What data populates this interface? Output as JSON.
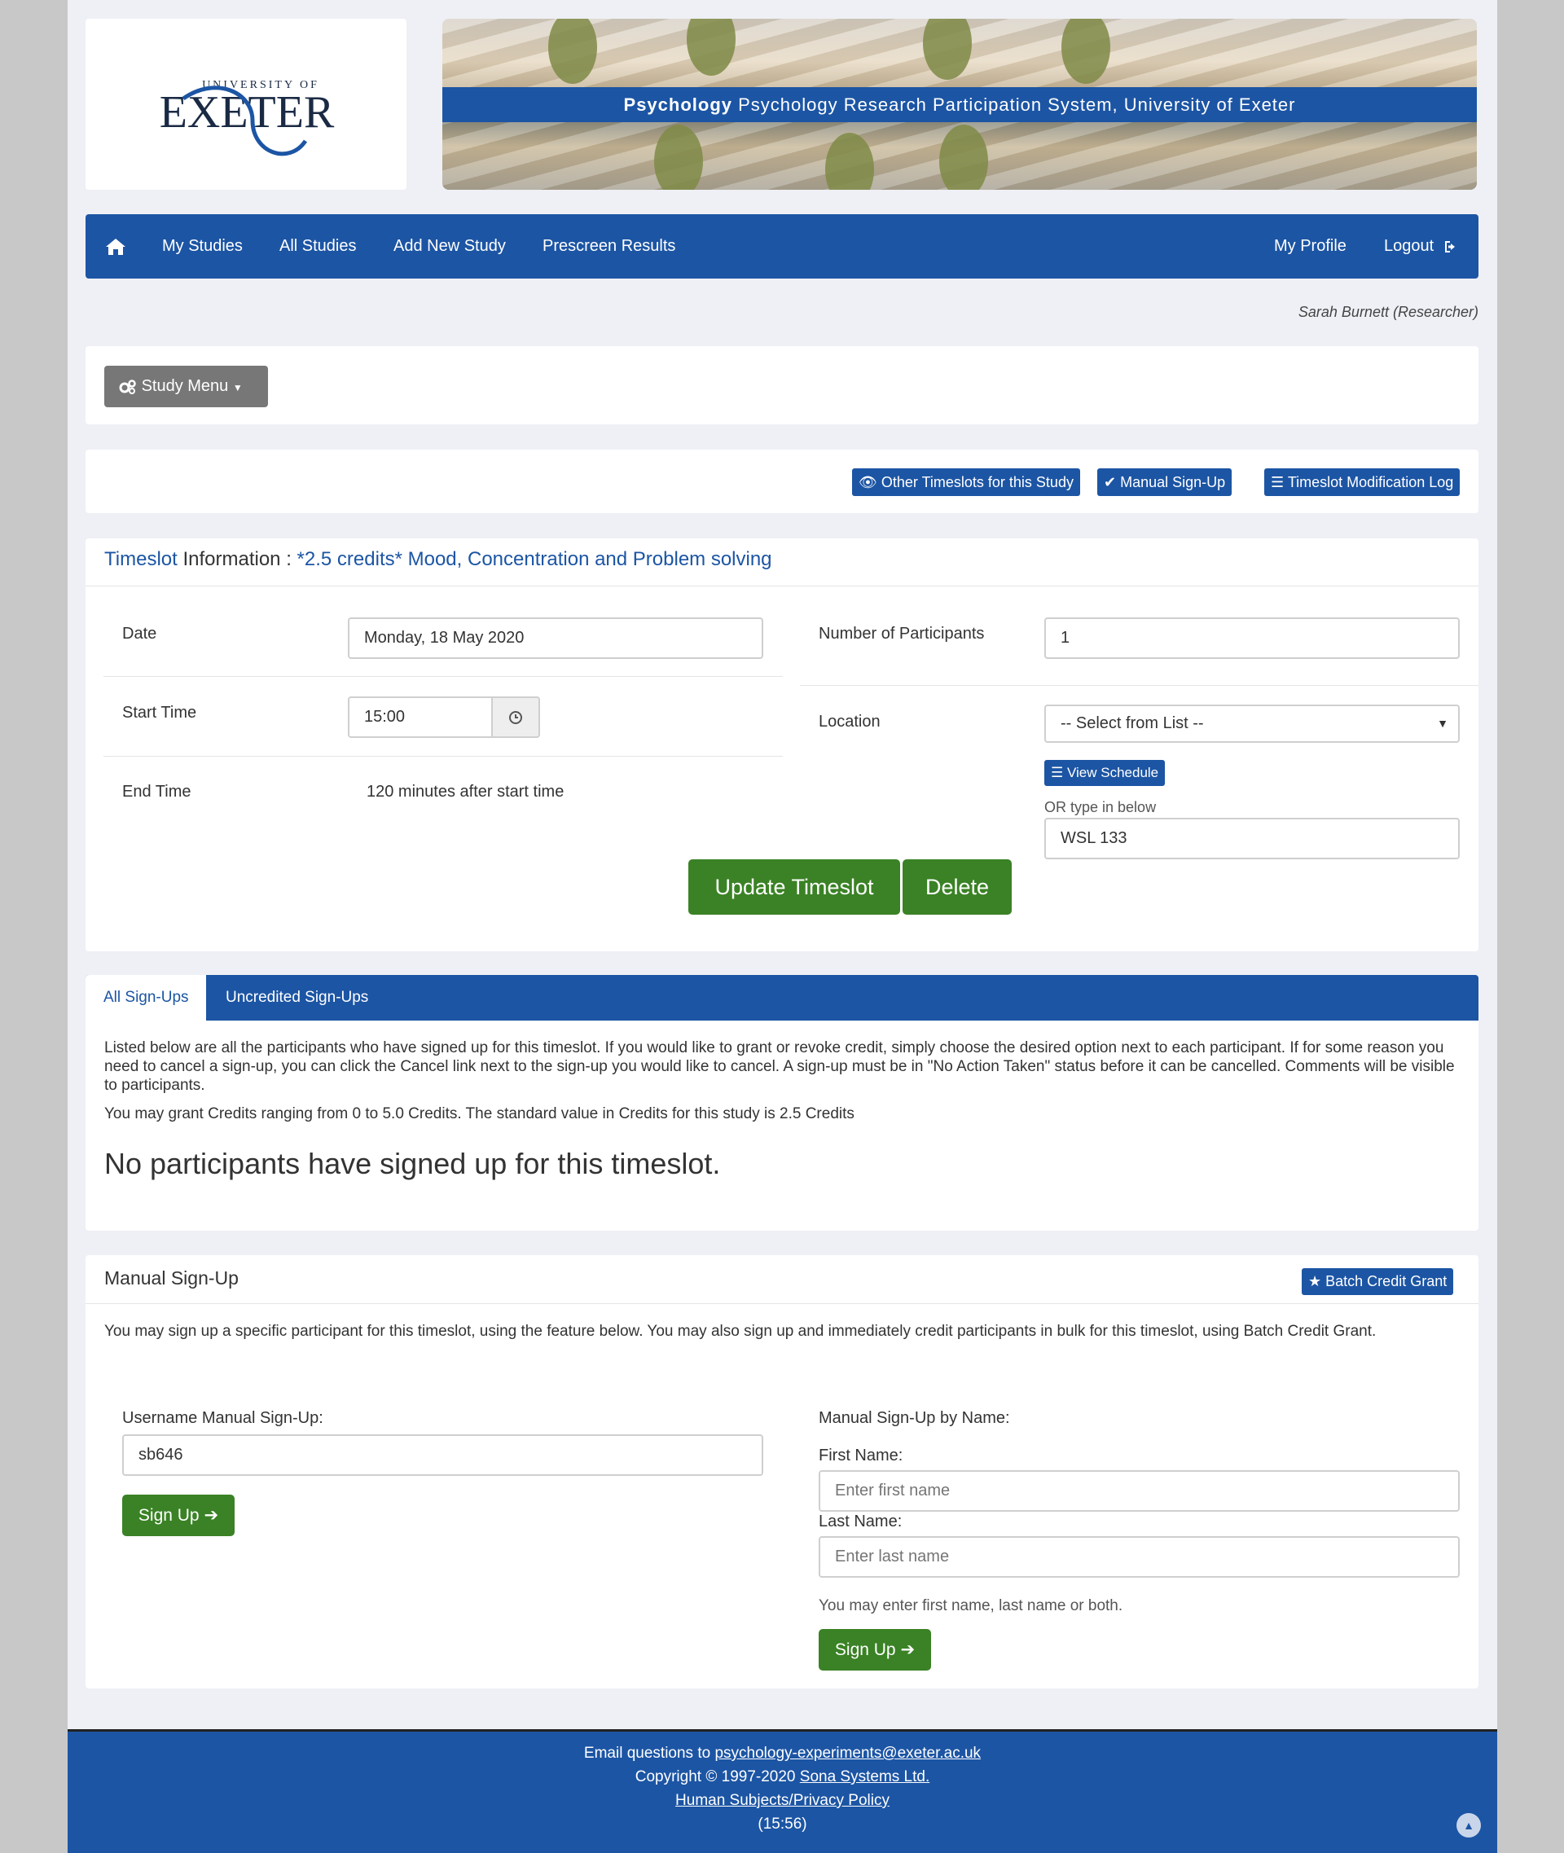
{
  "header": {
    "logo_top": "UNIVERSITY OF",
    "logo_main": "EXETER",
    "banner_bold": "Psychology",
    "banner_text": "Psychology Research Participation System, University of Exeter"
  },
  "nav": {
    "my_studies": "My Studies",
    "all_studies": "All Studies",
    "add_new_study": "Add New Study",
    "prescreen_results": "Prescreen Results",
    "my_profile": "My Profile",
    "logout": "Logout"
  },
  "user": {
    "name": "Sarah Burnett (Researcher)"
  },
  "study_menu": {
    "label": "Study Menu"
  },
  "actions": {
    "other_timeslots": "Other Timeslots for this Study",
    "manual_signup": "Manual Sign-Up",
    "modification_log": "Timeslot Modification Log"
  },
  "timeslot": {
    "heading_prefix": "Timeslot",
    "heading_info": "Information :",
    "study_name": "*2.5 credits* Mood, Concentration and Problem solving",
    "date_label": "Date",
    "date_value": "Monday, 18 May 2020",
    "start_label": "Start Time",
    "start_value": "15:00",
    "end_label": "End Time",
    "end_value": "120 minutes after start time",
    "participants_label": "Number of Participants",
    "participants_value": "1",
    "location_label": "Location",
    "location_select": "-- Select from List --",
    "view_schedule": "View Schedule",
    "or_type": "OR type in below",
    "location_value": "WSL 133",
    "update_button": "Update Timeslot",
    "delete_button": "Delete"
  },
  "signups": {
    "tab_all": "All Sign-Ups",
    "tab_uncredited": "Uncredited Sign-Ups",
    "description": "Listed below are all the participants who have signed up for this timeslot. If you would like to grant or revoke credit, simply choose the desired option next to each participant. If for some reason you need to cancel a sign-up, you can click the Cancel link next to the sign-up you would like to cancel. A sign-up must be in \"No Action Taken\" status before it can be cancelled. Comments will be visible to participants.",
    "credit_range": "You may grant Credits ranging from 0 to 5.0 Credits. The standard value in Credits for this study is 2.5 Credits",
    "empty_message": "No participants have signed up for this timeslot."
  },
  "manual_signup": {
    "title": "Manual Sign-Up",
    "batch_button": "Batch Credit Grant",
    "description": "You may sign up a specific participant for this timeslot, using the feature below. You may also sign up and immediately credit participants in bulk for this timeslot, using Batch Credit Grant.",
    "username_label": "Username Manual Sign-Up:",
    "username_value": "sb646",
    "signup_button": "Sign Up",
    "by_name_label": "Manual Sign-Up by Name:",
    "first_name_label": "First Name:",
    "first_name_placeholder": "Enter first name",
    "last_name_label": "Last Name:",
    "last_name_placeholder": "Enter last name",
    "hint": "You may enter first name, last name or both."
  },
  "footer": {
    "email_prefix": "Email questions to",
    "email": "psychology-experiments@exeter.ac.uk",
    "copyright_prefix": "Copyright © 1997-2020",
    "company": "Sona Systems Ltd.",
    "privacy": "Human Subjects/Privacy Policy",
    "time": "(15:56)"
  },
  "colors": {
    "brand_blue": "#1c55a4",
    "green": "#3a8225",
    "grey_button": "#777777"
  }
}
